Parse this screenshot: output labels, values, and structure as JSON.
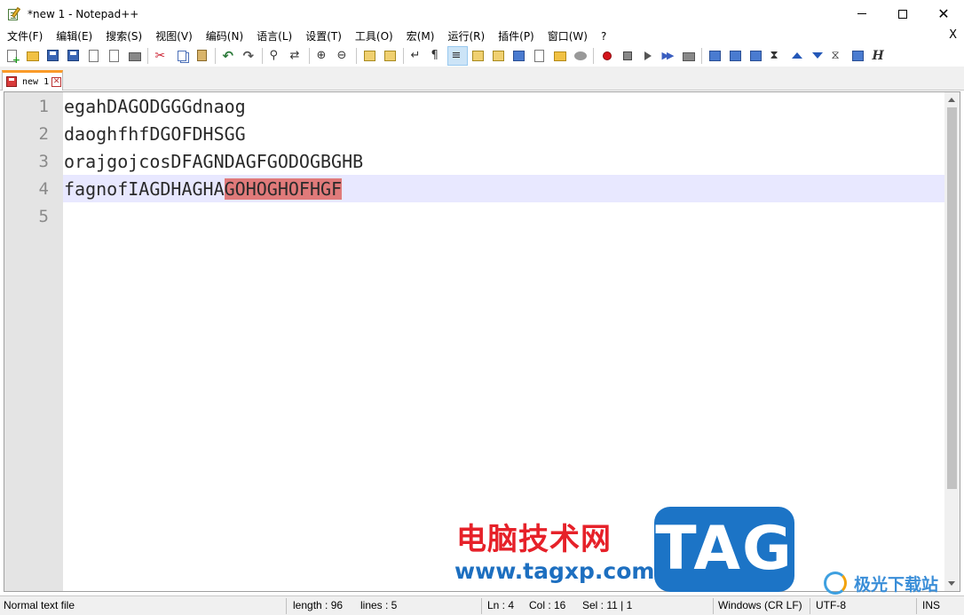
{
  "window": {
    "title": "*new 1 - Notepad++",
    "minimize_icon": "minimize-icon",
    "maximize_icon": "maximize-icon",
    "close_label": "✕"
  },
  "menu": {
    "items": [
      "文件(F)",
      "编辑(E)",
      "搜索(S)",
      "视图(V)",
      "编码(N)",
      "语言(L)",
      "设置(T)",
      "工具(O)",
      "宏(M)",
      "运行(R)",
      "插件(P)",
      "窗口(W)",
      "?"
    ],
    "close_doc": "X"
  },
  "toolbar": {
    "icons": [
      "new-file-icon",
      "open-file-icon",
      "save-icon",
      "save-all-icon",
      "close-icon",
      "close-all-icon",
      "print-icon",
      "cut-icon",
      "copy-icon",
      "paste-icon",
      "undo-icon",
      "redo-icon",
      "find-icon",
      "replace-icon",
      "zoom-in-icon",
      "zoom-out-icon",
      "sync-vertical-icon",
      "sync-horizontal-icon",
      "word-wrap-icon",
      "show-all-chars-icon",
      "indent-guide-icon",
      "udl-icon",
      "doc-map-icon",
      "doc-list-icon",
      "function-list-icon",
      "folder-workspace-icon",
      "monitoring-icon",
      "record-macro-icon",
      "stop-macro-icon",
      "play-macro-icon",
      "run-macro-multiple-icon",
      "save-macro-icon",
      "plugin-icon-1",
      "plugin-icon-2",
      "plugin-icon-3",
      "plugin-icon-4",
      "arrow-up-icon",
      "arrow-down-icon",
      "plugin-icon-5",
      "plugin-icon-6",
      "h-icon"
    ]
  },
  "tabs": [
    {
      "label": "new 1",
      "close": "✕",
      "active": true
    }
  ],
  "editor": {
    "line_numbers": [
      "1",
      "2",
      "3",
      "4",
      "5"
    ],
    "lines": [
      {
        "text": "egahDAGODGGGdnaog"
      },
      {
        "text": "daoghfhfDGOFDHSGG"
      },
      {
        "text": "orajgojcosDFAGNDAGFGODOGBGHB"
      },
      {
        "text_before": "fagnofIAGDHAGHA",
        "text_selected": "GOHOGHOFHGF"
      },
      {
        "text": ""
      }
    ],
    "colors": {
      "gutter_bg": "#e4e4e4",
      "current_line_bg": "#e8e8ff",
      "selection_bg": "#e07a7a"
    }
  },
  "watermark": {
    "cn_text": "电脑技术网",
    "url": "www.tagxp.com",
    "tag": "TAG",
    "brand": "极光下载站"
  },
  "statusbar": {
    "file_type": "Normal text file",
    "length": "length : 96",
    "lines": "lines : 5",
    "ln": "Ln : 4",
    "col": "Col : 16",
    "sel": "Sel : 11 | 1",
    "eol": "Windows (CR LF)",
    "encoding": "UTF-8",
    "mode": "INS"
  }
}
